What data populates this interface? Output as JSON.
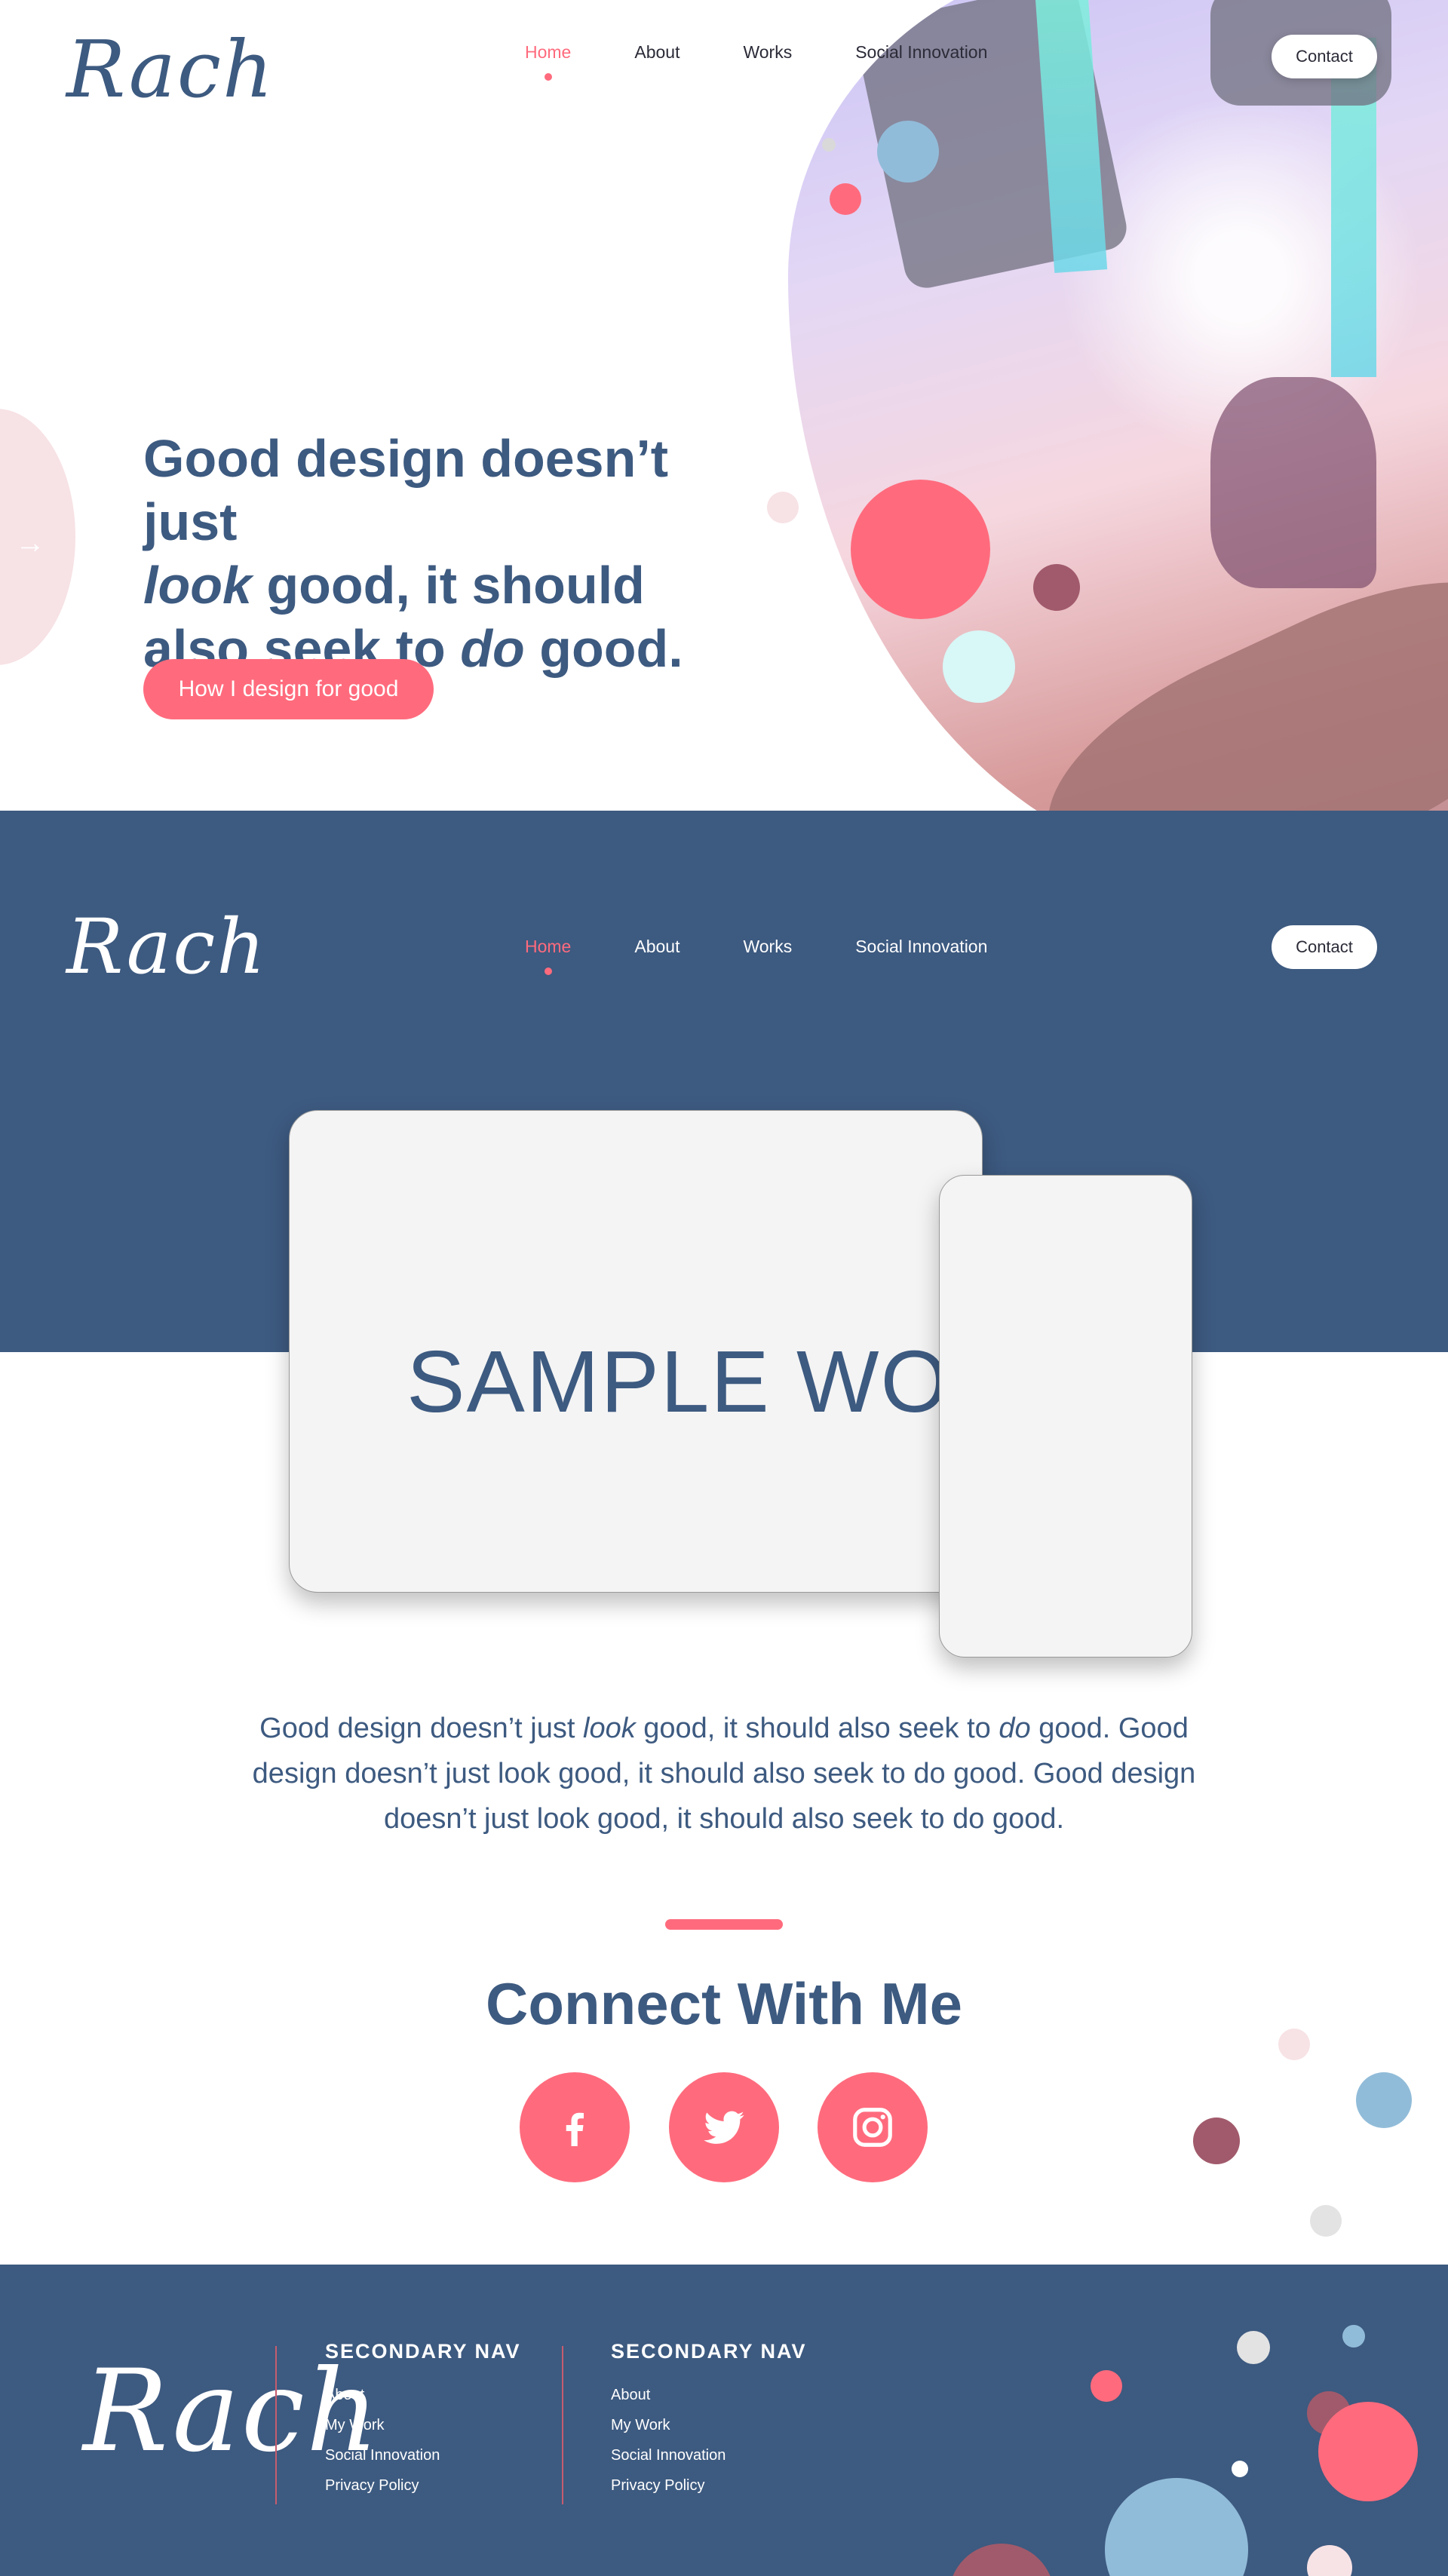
{
  "brand": {
    "logo_text": "Rach"
  },
  "nav": {
    "items": [
      "Home",
      "About",
      "Works",
      "Social Innovation"
    ],
    "active": "Home",
    "contact_label": "Contact"
  },
  "hero": {
    "heading_part1": "Good design doesn’t just",
    "heading_em1": "look",
    "heading_part2": " good, it should also seek to ",
    "heading_em2": "do",
    "heading_part3": " good.",
    "cta_label": "How I design for good"
  },
  "work": {
    "sample_title": "SAMPLE WORK",
    "description_p1": "Good design doesn’t just ",
    "description_em1": "look",
    "description_p2": " good, it should also seek to ",
    "description_em2": "do",
    "description_p3": " good. Good design doesn’t just look good, it should also seek to do good. Good design doesn’t just look good, it should also seek to do good."
  },
  "connect": {
    "title": "Connect With Me",
    "socials": [
      "facebook-icon",
      "twitter-icon",
      "instagram-icon"
    ]
  },
  "footer": {
    "logo_text": "Rach",
    "columns": [
      {
        "heading": "SECONDARY NAV",
        "links": [
          "About",
          "My Work",
          "Social Innovation",
          "Privacy Policy"
        ]
      },
      {
        "heading": "SECONDARY NAV",
        "links": [
          "About",
          "My Work",
          "Social Innovation",
          "Privacy Policy"
        ]
      }
    ]
  },
  "colors": {
    "primary_blue": "#3d5a80",
    "accent_pink": "#ff6b7d",
    "light_blue": "#91bcd9",
    "maroon": "#a15a6b",
    "pale_pink": "#f7e2e5"
  }
}
